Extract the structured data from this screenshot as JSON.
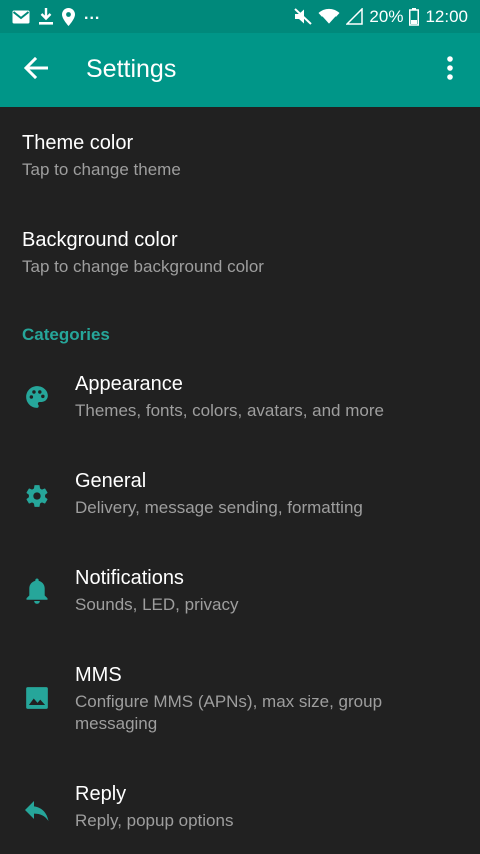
{
  "status_bar": {
    "battery_percent": "20%",
    "time": "12:00",
    "overflow_indicator": "...",
    "icons": [
      "mail-icon",
      "download-icon",
      "location-icon",
      "mute-icon",
      "wifi-icon",
      "signal-icon",
      "battery-icon"
    ]
  },
  "toolbar": {
    "title": "Settings",
    "back_icon": "arrow-back-icon",
    "menu_icon": "more-vert-icon"
  },
  "prefs": {
    "theme": {
      "title": "Theme color",
      "summary": "Tap to change theme"
    },
    "background": {
      "title": "Background color",
      "summary": "Tap to change background color"
    }
  },
  "categories_header": "Categories",
  "categories": [
    {
      "title": "Appearance",
      "summary": "Themes, fonts, colors, avatars, and more",
      "icon": "palette-icon"
    },
    {
      "title": "General",
      "summary": "Delivery, message sending, formatting",
      "icon": "gear-icon"
    },
    {
      "title": "Notifications",
      "summary": "Sounds, LED, privacy",
      "icon": "bell-icon"
    },
    {
      "title": "MMS",
      "summary": "Configure MMS (APNs), max size, group messaging",
      "icon": "image-icon"
    },
    {
      "title": "Reply",
      "summary": "Reply, popup options",
      "icon": "reply-icon"
    }
  ],
  "colors": {
    "status_bar": "#00897b",
    "toolbar": "#009688",
    "background": "#212121",
    "accent": "#26a69a",
    "summary_text": "#9e9e9e"
  }
}
